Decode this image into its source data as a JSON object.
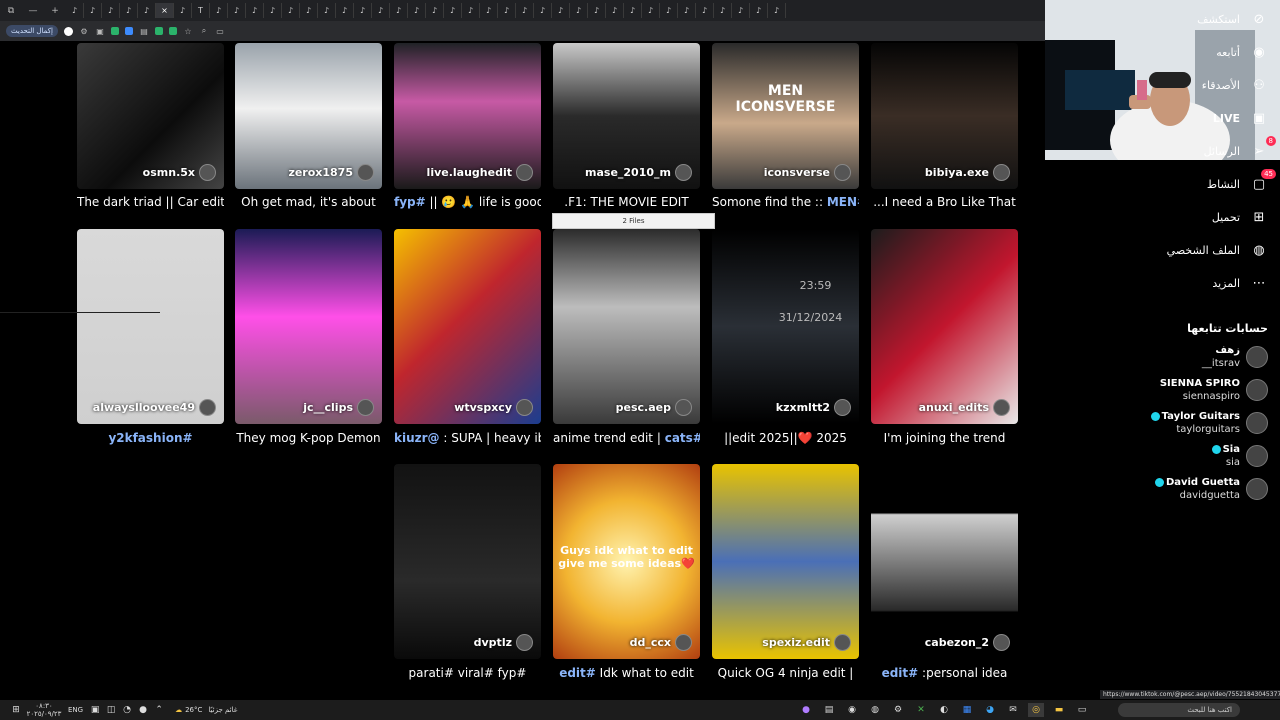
{
  "browser": {
    "update_button": "إكمال التحديث",
    "tab_count_icons": 40
  },
  "videos": [
    {
      "user": "osmn.5x",
      "caption_plain": "The dark triad || Car edit",
      "tag": ""
    },
    {
      "user": "zerox1875",
      "caption_plain": "Oh get mad, it's about",
      "tag": ""
    },
    {
      "user": "live.laughedit",
      "caption_plain": "|| 🥲 🙏 life is good",
      "tag": "fyp#"
    },
    {
      "user": "mase_2010_m",
      "caption_plain": ".F1: THE MOVIE EDIT",
      "tag": ""
    },
    {
      "user": "iconsverse",
      "caption_plain": "Somone find the ::",
      "tag": "MEN#"
    },
    {
      "user": "bibiya.exe",
      "caption_plain": "...I need a Bro Like That",
      "tag": ""
    },
    {
      "user": "alwayslloovee49",
      "caption_plain": "",
      "tag": "y2kfashion#"
    },
    {
      "user": "jc__clips",
      "caption_plain": "They mog K-pop Demon",
      "tag": ""
    },
    {
      "user": "wtvspxcy",
      "caption_plain": ": SUPA | heavy ib",
      "tag": "kiuzr@"
    },
    {
      "user": "pesc.aep",
      "caption_plain": "anime trend edit |",
      "tag": "cats#"
    },
    {
      "user": "kzxmltt2",
      "caption_plain": "||edit 2025||❤️ 2025",
      "tag": ""
    },
    {
      "user": "anuxi_edits",
      "caption_plain": "I'm joining the trend",
      "tag": ""
    },
    {
      "user": "dvptlz",
      "caption_plain": "parati# viral# fyp#",
      "tag": ""
    },
    {
      "user": "dd_ccx",
      "caption_plain": "Idk what to edit",
      "tag": "edit#"
    },
    {
      "user": "spexiz.edit",
      "caption_plain": "Quick OG 4 ninja edit |",
      "tag": ""
    },
    {
      "user": "cabezon_2",
      "caption_plain": ":personal idea",
      "tag": "edit#"
    }
  ],
  "thumb_texts": {
    "iconsverse": "MEN\nICONSVERSE",
    "dd_ccx": "Guys idk what to edit give me some ideas❤️",
    "kzxmltt2_time": "23:59",
    "kzxmltt2_date": "31/12/2024"
  },
  "clip_badge": "2 Files",
  "sidebar": {
    "nav": [
      {
        "label": "استكشف",
        "icon": "compass-icon",
        "badge": ""
      },
      {
        "label": "أتابعه",
        "icon": "following-avatar-icon",
        "badge": ""
      },
      {
        "label": "الأصدقاء",
        "icon": "friends-icon",
        "badge": ""
      },
      {
        "label": "LIVE",
        "icon": "live-icon",
        "badge": ""
      },
      {
        "label": "الرسائل",
        "icon": "messages-icon",
        "badge": "8"
      },
      {
        "label": "النشاط",
        "icon": "activity-icon",
        "badge": "45"
      },
      {
        "label": "تحميل",
        "icon": "upload-icon",
        "badge": ""
      },
      {
        "label": "الملف الشخصي",
        "icon": "profile-icon",
        "badge": ""
      },
      {
        "label": "المزيد",
        "icon": "more-icon",
        "badge": ""
      }
    ],
    "following_title": "حسابات تتابعها",
    "following": [
      {
        "name": "زهف",
        "handle": "__itsrav",
        "verified": false
      },
      {
        "name": "SIENNA SPIRO",
        "handle": "siennaspiro",
        "verified": false
      },
      {
        "name": "Taylor Guitars",
        "handle": "taylorguitars",
        "verified": true
      },
      {
        "name": "Sia",
        "handle": "sia",
        "verified": true
      },
      {
        "name": "David Guetta",
        "handle": "davidguetta",
        "verified": true
      }
    ]
  },
  "status_url": "https://www.tiktok.com/@pesc.aep/video/7552184304537701839",
  "taskbar": {
    "time": "٠٨:٣٠",
    "date": "٢٠٢٥/٠٩/٢٣",
    "lang": "ENG",
    "weather": "26°C",
    "weather_label": "غائم جزئيًا",
    "search_placeholder": "اكتب هنا للبحث"
  },
  "colors": {
    "accent": "#fe2c55",
    "link": "#8ab4f8"
  }
}
